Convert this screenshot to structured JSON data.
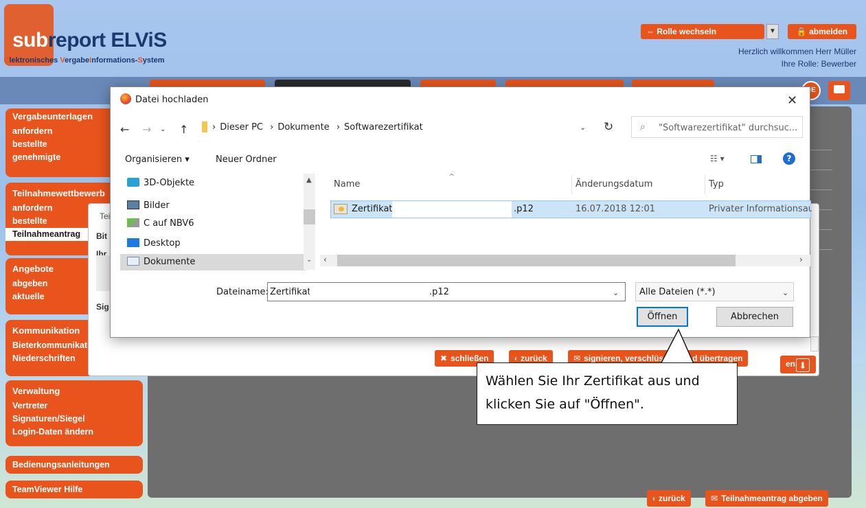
{
  "header": {
    "brand_sub": "sub",
    "brand_rest": "report ELViS",
    "tagline_parts": [
      "E",
      "lektronisches ",
      "V",
      "ergabe",
      "I",
      "nformations-",
      "S",
      "ystem"
    ],
    "role_switch": "⇔ Rolle wechseln",
    "logout": "abmelden",
    "welcome": "Herzlich willkommen Herr Müller",
    "role": "Ihre Rolle: Bewerber",
    "lang": "DE"
  },
  "sidebar": {
    "vergabe": {
      "head": "Vergabeunterlagen",
      "items": [
        "anfordern",
        "bestellte",
        "genehmigte"
      ]
    },
    "teilnahme": {
      "head": "Teilnahmewettbewerb",
      "items": [
        "anfordern",
        "bestellte",
        "Teilnahmeantrag"
      ]
    },
    "angebote": {
      "head": "Angebote",
      "items": [
        "abgeben",
        "aktuelle"
      ]
    },
    "kommunikation": {
      "head": "Kommunikation",
      "items": [
        "Bieterkommunikation",
        "Niederschriften"
      ]
    },
    "verwaltung": {
      "head": "Verwaltung",
      "items": [
        "Vertreter",
        "Signaturen/Siegel",
        "Login-Daten ändern"
      ]
    },
    "anleitungen": "Bedienungsanleitungen",
    "teamviewer": "TeamViewer Hilfe"
  },
  "bg_dialog": {
    "title_partial": "Tei",
    "label_bit": "Bit",
    "label_ihr": "Ihr",
    "label_sig": "Sig",
    "close_btn": "schließen",
    "back_btn": "zurück",
    "sign_btn": "signieren, verschlüsseln und übertragen",
    "en_partial": "en"
  },
  "file_dialog": {
    "title": "Datei hochladen",
    "breadcrumb": [
      "Dieser PC",
      "Dokumente",
      "Softwarezertifikat"
    ],
    "search_placeholder": "\"Softwarezertifikat\" durchsuc...",
    "organize": "Organisieren ▾",
    "new_folder": "Neuer Ordner",
    "tree": [
      "3D-Objekte",
      "Bilder",
      "C auf NBV6",
      "Desktop",
      "Dokumente"
    ],
    "columns": {
      "name": "Name",
      "date": "Änderungsdatum",
      "type": "Typ"
    },
    "file": {
      "name": "Zertifikat_",
      "ext": ".p12",
      "date": "16.07.2018 12:01",
      "type": "Privater Informationsaustausch"
    },
    "filename_label": "Dateiname:",
    "filename_value": "Zertifikat_",
    "filename_ext": ".p12",
    "filetype": "Alle Dateien (*.*)",
    "open": "Öffnen",
    "cancel": "Abbrechen"
  },
  "callout": {
    "line1": "Wählen Sie Ihr Zertifikat aus und",
    "line2": "klicken Sie auf \"Öffnen\"."
  },
  "bottom": {
    "back": "zurück",
    "submit": "Teilnahmeantrag abgeben"
  },
  "colors": {
    "accent": "#e8541b",
    "brand": "#1a3a6e",
    "selection": "#cce4f7"
  }
}
